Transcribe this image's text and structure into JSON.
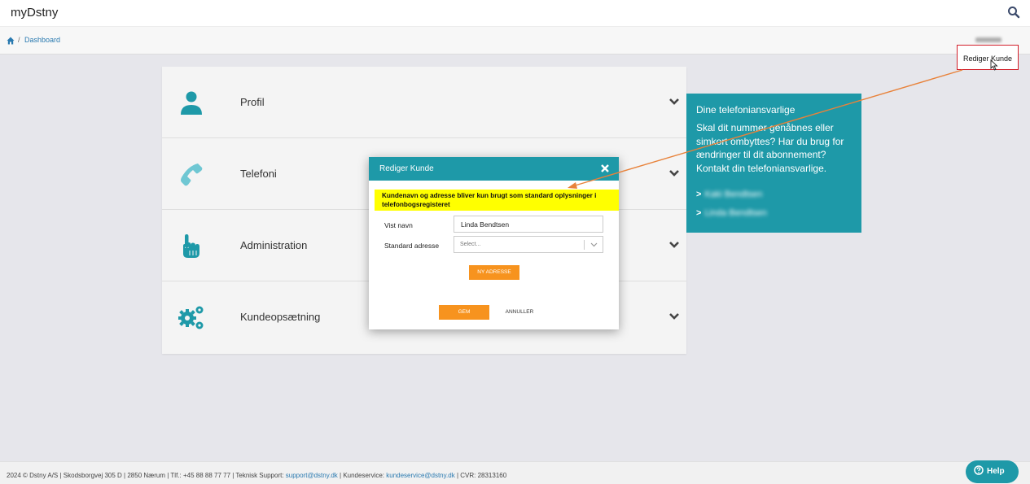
{
  "app": {
    "brand": "myDstny"
  },
  "breadcrumb": {
    "separator": "/",
    "current": "Dashboard"
  },
  "header": {
    "edit_customer_label": "Rediger Kunde"
  },
  "cards": [
    {
      "label": "Profil",
      "icon": "user-icon"
    },
    {
      "label": "Telefoni",
      "icon": "phone-icon"
    },
    {
      "label": "Administration",
      "icon": "pointer-hand-icon"
    },
    {
      "label": "Kundeopsætning",
      "icon": "gears-icon"
    }
  ],
  "side_panel": {
    "title": "Dine telefoniansvarlige",
    "text": "Skal dit nummer genåbnes eller simkort ombyttes? Har du brug for ændringer til dit abonnement? Kontakt din telefoniansvarlige.",
    "contacts": [
      "Kaki Bendtsen",
      "Linda Bendtsen"
    ]
  },
  "modal": {
    "title": "Rediger Kunde",
    "notice": "Kundenavn og adresse bliver kun brugt som standard oplysninger i telefonbogsregisteret",
    "name_label": "Vist navn",
    "name_value": "Linda Bendtsen",
    "address_label": "Standard adresse",
    "address_placeholder": "Select...",
    "new_address_button": "NY ADRESSE",
    "save_button": "GEM",
    "cancel_button": "ANNULLER"
  },
  "footer": {
    "text_before": "2024 © Dstny A/S | Skodsborgvej 305 D | 2850 Nærum | Tlf.: +45 88 88 77 77 | Teknisk Support: ",
    "support_email": "support@dstny.dk",
    "text_middle": " | Kundeservice: ",
    "service_email": "kundeservice@dstny.dk",
    "text_after": " | CVR: 28313160"
  },
  "help": {
    "label": "Help"
  },
  "colors": {
    "teal": "#1e99a8",
    "orange": "#f7931e",
    "highlight": "#ffff00",
    "annotation_red": "#d21f2a",
    "annotation_arrow": "#e8823a"
  }
}
